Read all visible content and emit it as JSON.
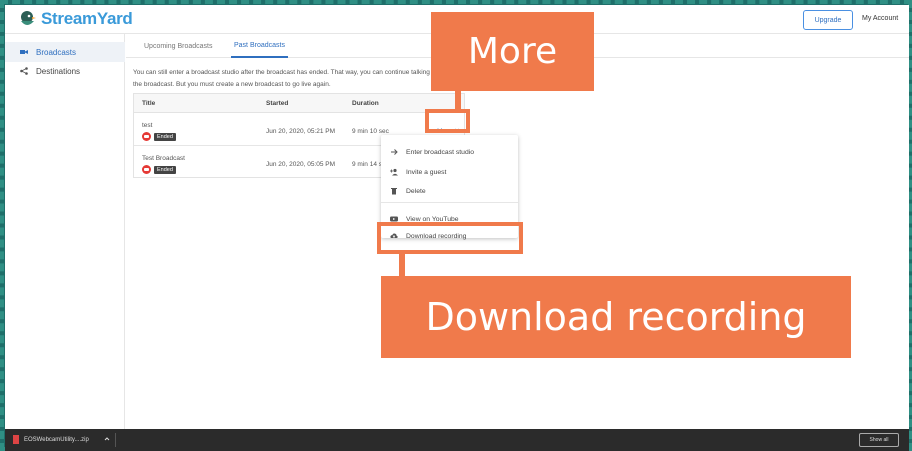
{
  "header": {
    "logo_text": "StreamYard",
    "upgrade_label": "Upgrade",
    "account_label": "My Account"
  },
  "sidebar": {
    "items": [
      {
        "label": "Broadcasts",
        "icon": "video-camera-icon",
        "active": true
      },
      {
        "label": "Destinations",
        "icon": "share-icon",
        "active": false
      }
    ]
  },
  "tabs": [
    {
      "label": "Upcoming Broadcasts",
      "active": false
    },
    {
      "label": "Past Broadcasts",
      "active": true
    }
  ],
  "intro": {
    "line1": "You can still enter a broadcast studio after the broadcast has ended. That way, you can continue talking to",
    "line2": "the broadcast. But you must create a new broadcast to go live again."
  },
  "table": {
    "columns": [
      "Title",
      "Started",
      "Duration"
    ],
    "rows": [
      {
        "title": "test",
        "status": "Ended",
        "started": "Jun 20, 2020, 05:21 PM",
        "duration": "9 min 10 sec"
      },
      {
        "title": "Test Broadcast",
        "status": "Ended",
        "started": "Jun 20, 2020, 05:05 PM",
        "duration": "9 min 14 se"
      }
    ]
  },
  "more_button": {
    "label": "More"
  },
  "menu": {
    "items": [
      {
        "label": "Enter broadcast studio",
        "icon": "arrow-right-icon"
      },
      {
        "label": "Invite a guest",
        "icon": "add-person-icon"
      },
      {
        "label": "Delete",
        "icon": "trash-icon"
      },
      {
        "label": "View on YouTube",
        "icon": "youtube-icon"
      },
      {
        "label": "Download recording",
        "icon": "cloud-download-icon"
      }
    ]
  },
  "annotations": {
    "more": "More",
    "download": "Download recording"
  },
  "taskbar": {
    "download_file": "EOSWebcamUtility....zip",
    "show_all": "Show all"
  },
  "colors": {
    "accent": "#2f6fbf",
    "callout": "#f07a4b",
    "border_teal": "#2f8f84",
    "live_red": "#e53935"
  }
}
